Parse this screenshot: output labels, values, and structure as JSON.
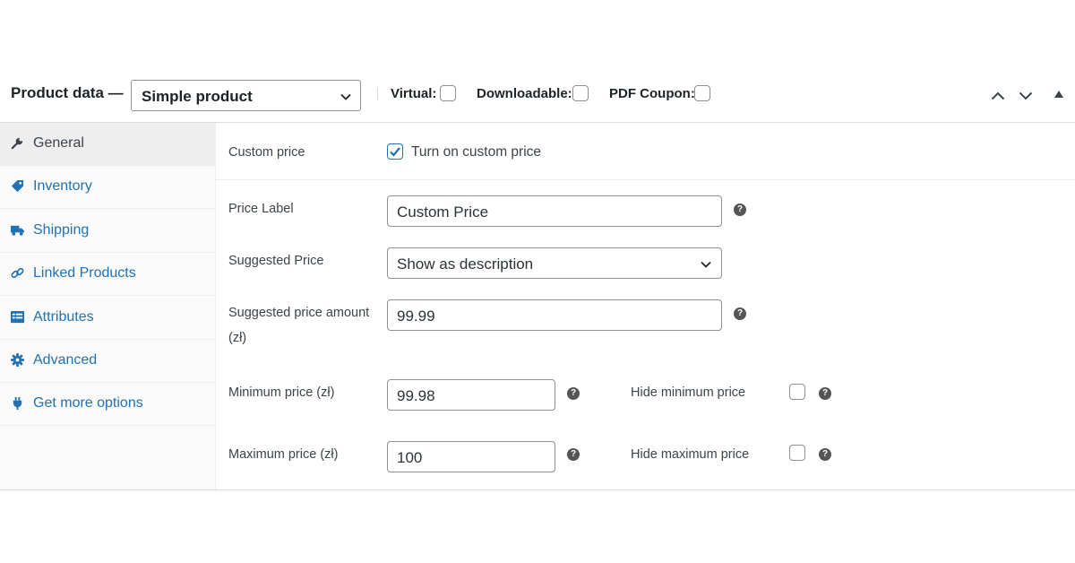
{
  "header": {
    "title": "Product data —",
    "product_type": "Simple product",
    "options": [
      {
        "label": "Virtual:",
        "checked": false
      },
      {
        "label": "Downloadable:",
        "checked": false
      },
      {
        "label": "PDF Coupon:",
        "checked": false
      }
    ],
    "icons": [
      "chevron-up-icon",
      "chevron-down-icon",
      "triangle-up-icon"
    ]
  },
  "sidebar": {
    "items": [
      {
        "label": "General",
        "icon": "wrench-icon",
        "active": true
      },
      {
        "label": "Inventory",
        "icon": "tag-icon",
        "active": false
      },
      {
        "label": "Shipping",
        "icon": "truck-icon",
        "active": false
      },
      {
        "label": "Linked Products",
        "icon": "link-icon",
        "active": false
      },
      {
        "label": "Attributes",
        "icon": "list-icon",
        "active": false
      },
      {
        "label": "Advanced",
        "icon": "gear-icon",
        "active": false
      },
      {
        "label": "Get more options",
        "icon": "plugin-icon",
        "active": false
      }
    ]
  },
  "form": {
    "custom_price": {
      "label": "Custom price",
      "checkbox_label": "Turn on custom price",
      "checked": true
    },
    "price_label": {
      "label": "Price Label",
      "value": "Custom Price"
    },
    "suggested_price": {
      "label": "Suggested Price",
      "value": "Show as description"
    },
    "suggested_amount": {
      "label_line1": "Suggested price amount",
      "label_line2": "(zł)",
      "value": "99.99"
    },
    "minimum_price": {
      "label": "Minimum price (zł)",
      "value": "99.98",
      "hide_label": "Hide minimum price",
      "hide_checked": false
    },
    "maximum_price": {
      "label": "Maximum price (zł)",
      "value": "100",
      "hide_label": "Hide maximum price",
      "hide_checked": false
    }
  },
  "colors": {
    "link": "#2271b1",
    "checkbox_accent": "#2271b1",
    "help_icon": "#555555"
  }
}
